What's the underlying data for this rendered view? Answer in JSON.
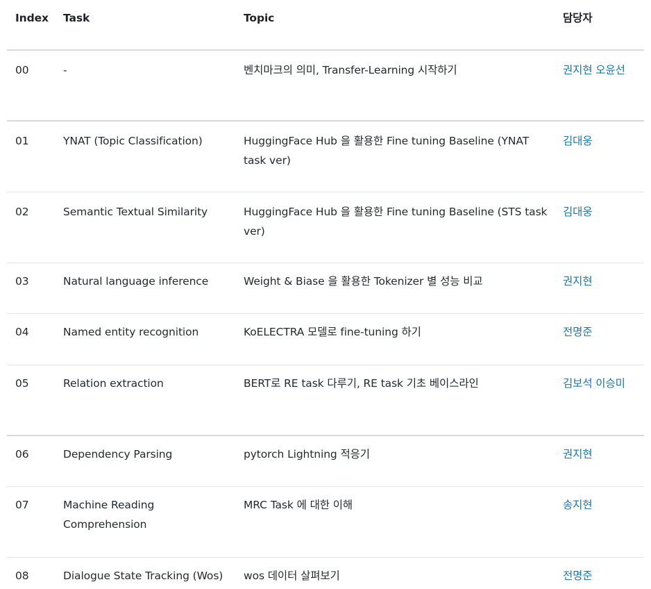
{
  "headers": {
    "index": "Index",
    "task": "Task",
    "topic": "Topic",
    "owner": "담당자"
  },
  "rows": [
    {
      "index": "00",
      "task": "-",
      "topic": "벤치마크의 의미, Transfer-Learning 시작하기",
      "owner": "권지현 오윤선"
    },
    {
      "index": "01",
      "task": "YNAT (Topic Classification)",
      "topic": "HuggingFace Hub 을 활용한 Fine tuning Baseline (YNAT task ver)",
      "owner": "김대웅"
    },
    {
      "index": "02",
      "task": "Semantic Textual Similarity",
      "topic": "HuggingFace Hub 을 활용한 Fine tuning Baseline (STS task ver)",
      "owner": "김대웅"
    },
    {
      "index": "03",
      "task": "Natural language inference",
      "topic": "Weight & Biase 을 활용한 Tokenizer 별 성능 비교",
      "owner": "권지현"
    },
    {
      "index": "04",
      "task": "Named entity recognition",
      "topic": "KoELECTRA 모델로 fine-tuning 하기",
      "owner": "전명준"
    },
    {
      "index": "05",
      "task": "Relation extraction",
      "topic": "BERT로 RE task 다루기, RE task 기초 베이스라인",
      "owner": "김보석 이승미"
    },
    {
      "index": "06",
      "task": "Dependency Parsing",
      "topic": "pytorch Lightning 적응기",
      "owner": "권지현"
    },
    {
      "index": "07",
      "task": "Machine Reading Comprehension",
      "topic": "MRC Task 에 대한 이해",
      "owner": "송지현"
    },
    {
      "index": "08",
      "task": "Dialogue State Tracking (Wos)",
      "topic": "wos 데이터 살펴보기",
      "owner": "전명준"
    }
  ]
}
